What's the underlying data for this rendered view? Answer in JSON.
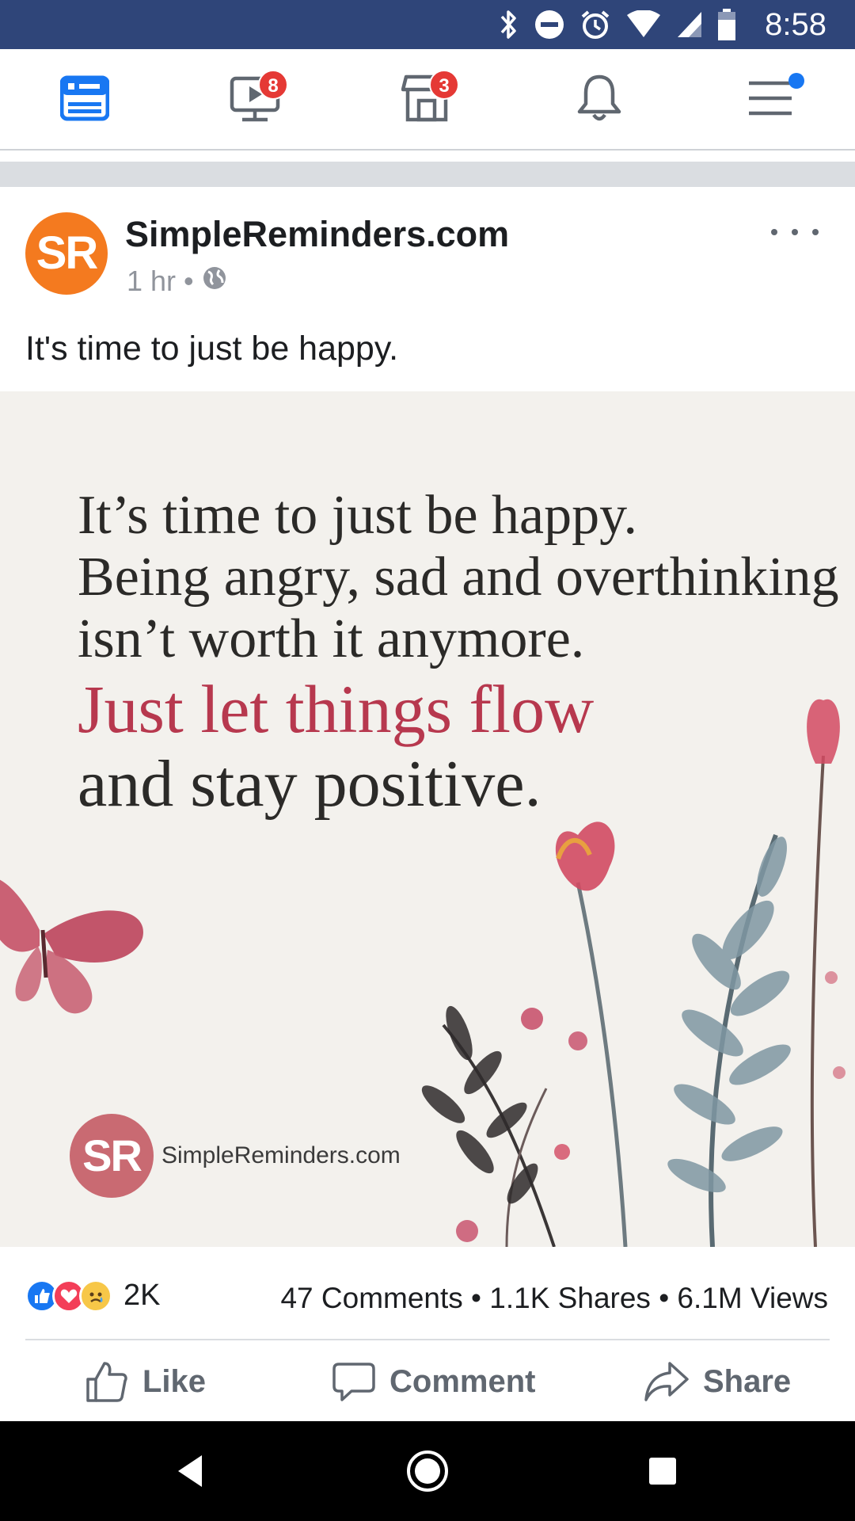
{
  "status_bar": {
    "time": "8:58",
    "icons": [
      "bluetooth-icon",
      "do-not-disturb-icon",
      "alarm-icon",
      "wifi-icon",
      "signal-icon",
      "battery-icon"
    ],
    "background_color": "#2f4579"
  },
  "top_nav": {
    "items": [
      {
        "name": "news-feed",
        "icon": "news-feed-icon",
        "active": true
      },
      {
        "name": "watch",
        "icon": "video-icon",
        "badge": "8"
      },
      {
        "name": "marketplace",
        "icon": "marketplace-icon",
        "badge": "3"
      },
      {
        "name": "notifications",
        "icon": "bell-icon"
      },
      {
        "name": "menu",
        "icon": "menu-icon",
        "dot": true
      }
    ],
    "accent_color": "#1877f2"
  },
  "post": {
    "avatar_text": "SR",
    "page_name": "SimpleReminders.com",
    "time": "1 hr",
    "separator": "•",
    "privacy_icon": "globe-icon",
    "text": "It's time to just be happy.",
    "image": {
      "quote_lines": [
        "It’s time to just be happy.",
        "Being angry, sad and overthinking",
        "isn’t worth it anymore.",
        "Just let things flow",
        "and stay positive."
      ],
      "logo_text": "SR",
      "site_text": "SimpleReminders.com",
      "accent_color": "#b7384e"
    },
    "reactions": {
      "icons": [
        "like-reaction-icon",
        "love-reaction-icon",
        "sad-reaction-icon"
      ],
      "count": "2K"
    },
    "stats": "47 Comments • 1.1K Shares • 6.1M Views",
    "actions": {
      "like": "Like",
      "comment": "Comment",
      "share": "Share"
    }
  },
  "android_nav": {
    "buttons": [
      "back-icon",
      "home-icon",
      "recents-icon"
    ]
  }
}
